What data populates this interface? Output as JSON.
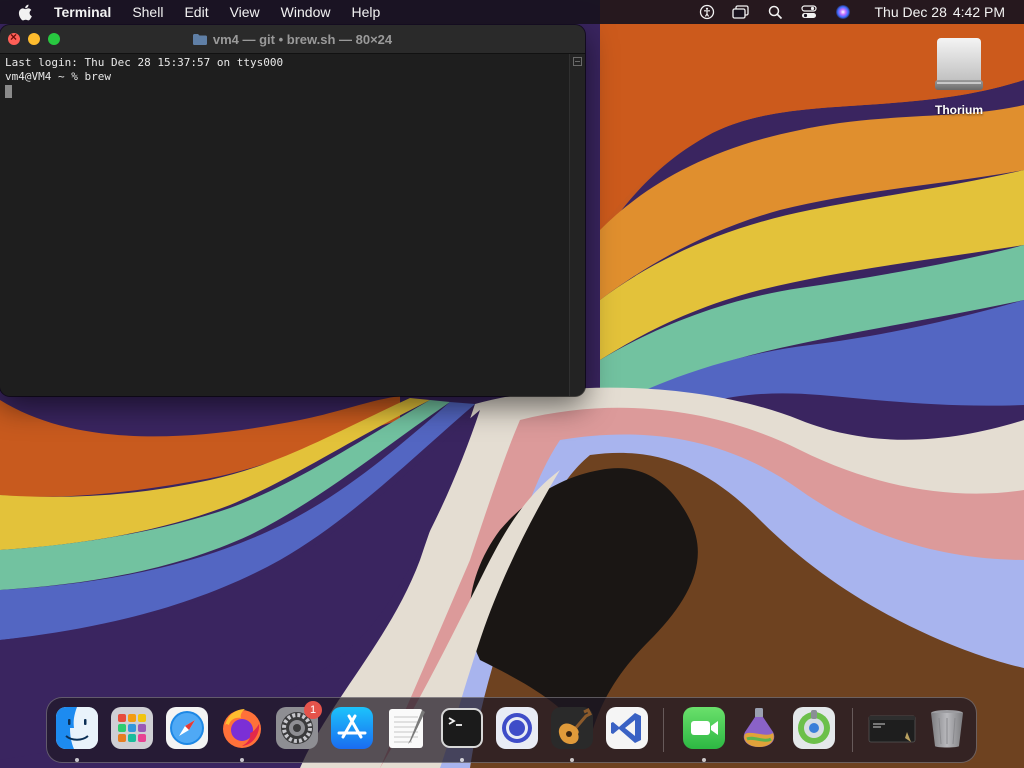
{
  "menubar": {
    "app_name": "Terminal",
    "menus": [
      "Shell",
      "Edit",
      "View",
      "Window",
      "Help"
    ],
    "clock": {
      "date": "Thu Dec 28",
      "time": "4:42 PM"
    }
  },
  "terminal": {
    "title": "vm4 — git • brew.sh — 80×24",
    "lines": [
      "Last login: Thu Dec 28 15:37:57 on ttys000",
      "vm4@VM4 ~ % brew"
    ]
  },
  "desktop": {
    "icons": [
      {
        "label": "Thorium",
        "icon": "drive-icon"
      }
    ]
  },
  "dock": {
    "items": [
      {
        "name": "finder",
        "icon": "finder-icon",
        "running": true
      },
      {
        "name": "launchpad",
        "icon": "launchpad-icon",
        "running": false
      },
      {
        "name": "safari",
        "icon": "safari-icon",
        "running": false
      },
      {
        "name": "firefox",
        "icon": "firefox-icon",
        "running": true
      },
      {
        "name": "system-settings",
        "icon": "gear-icon",
        "running": false,
        "badge": "1"
      },
      {
        "name": "app-store",
        "icon": "app-store-icon",
        "running": false
      },
      {
        "name": "textedit",
        "icon": "textedit-icon",
        "running": false
      },
      {
        "name": "terminal",
        "icon": "terminal-icon",
        "running": true
      },
      {
        "name": "browser",
        "icon": "browser-icon",
        "running": false
      },
      {
        "name": "garageband",
        "icon": "guitar-icon",
        "running": true
      },
      {
        "name": "vscode",
        "icon": "vscode-icon",
        "running": false
      },
      {
        "name": "facetime",
        "icon": "facetime-icon",
        "running": true
      },
      {
        "name": "potion",
        "icon": "potion-icon",
        "running": false
      },
      {
        "name": "disk-utility",
        "icon": "disk-icon",
        "running": false
      },
      {
        "name": "recent-terminal",
        "icon": "recent-window-icon",
        "running": false
      },
      {
        "name": "trash",
        "icon": "trash-icon",
        "running": false
      }
    ]
  },
  "colors": {
    "terminal_bg": "#1e1e1e",
    "menubar_bg": "#18121e",
    "close": "#ff5f57",
    "minimize": "#febc2e",
    "maximize": "#28c840"
  }
}
